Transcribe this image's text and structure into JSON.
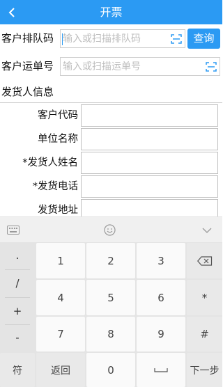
{
  "header": {
    "title": "开票",
    "back_icon": "chevron-left-icon"
  },
  "queue": {
    "label": "客户排队码",
    "placeholder": "输入或扫描排队码",
    "query_button": "查询"
  },
  "waybill": {
    "label": "客户运单号",
    "placeholder": "输入或扫描运单号"
  },
  "sender": {
    "section_title": "发货人信息",
    "fields": [
      {
        "label": "客户代码",
        "value": ""
      },
      {
        "label": "单位名称",
        "value": ""
      },
      {
        "label": "*发货人姓名",
        "value": ""
      },
      {
        "label": "*发货电话",
        "value": ""
      },
      {
        "label": "发货地址",
        "value": ""
      }
    ]
  },
  "keyboard": {
    "toolbar_icons": [
      "keyboard-icon",
      "emoji-icon",
      "collapse-icon"
    ],
    "symbols": [
      ".",
      "/",
      "+",
      "-"
    ],
    "keys": [
      "1",
      "2",
      "3",
      "4",
      "5",
      "6",
      "7",
      "8",
      "9",
      "0"
    ],
    "star_key": "*",
    "hash_key": "#",
    "symbol_switch": "符",
    "return_key": "返回",
    "next_key": "下一步"
  },
  "colors": {
    "accent": "#2b9af3",
    "keyboard_bg": "#e4e4e4"
  }
}
